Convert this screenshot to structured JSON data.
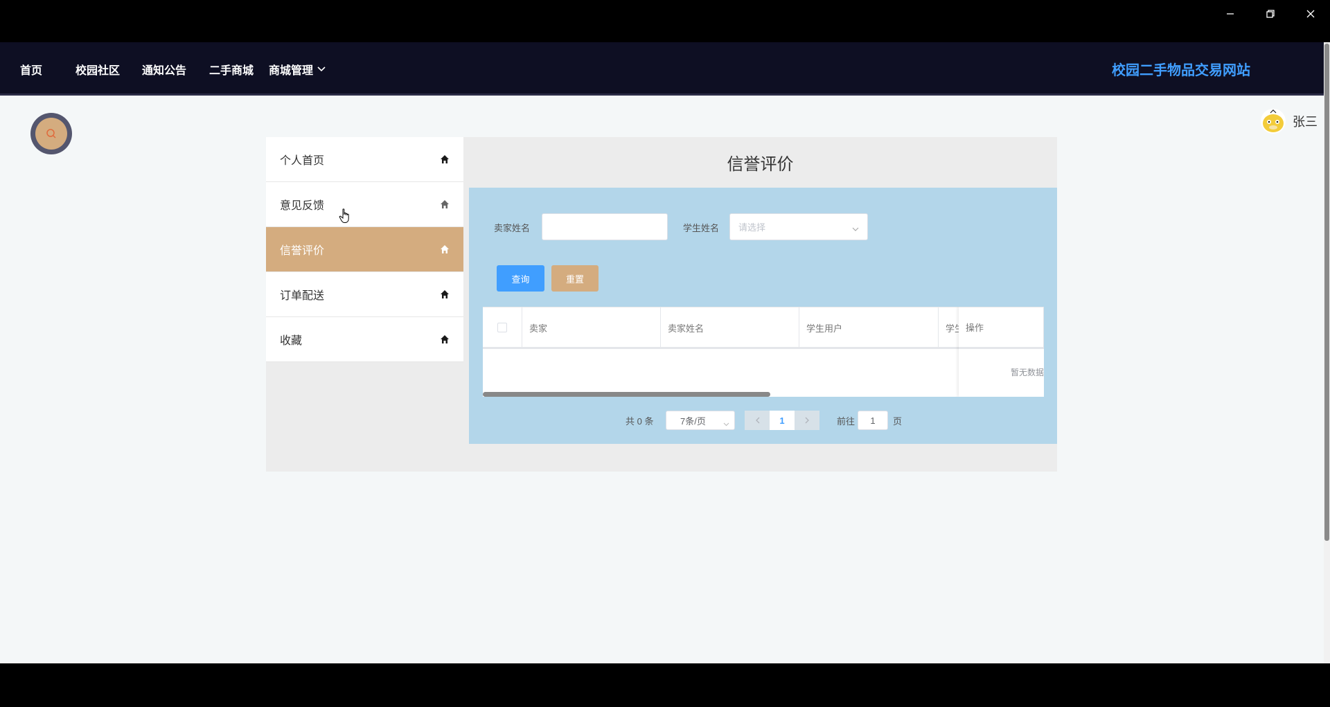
{
  "window": {
    "minimize_icon": "minimize-icon",
    "restore_icon": "restore-icon",
    "close_icon": "close-icon"
  },
  "nav": {
    "items": [
      {
        "label": "首页"
      },
      {
        "label": "校园社区"
      },
      {
        "label": "通知公告"
      },
      {
        "label": "二手商城"
      },
      {
        "label": "商城管理"
      }
    ],
    "site_title": "校园二手物品交易网站"
  },
  "user": {
    "name": "张三"
  },
  "sidebar": {
    "items": [
      {
        "label": "个人首页"
      },
      {
        "label": "意见反馈"
      },
      {
        "label": "信誉评价"
      },
      {
        "label": "订单配送"
      },
      {
        "label": "收藏"
      }
    ],
    "active_index": 2
  },
  "page": {
    "title": "信誉评价"
  },
  "filters": {
    "seller_label": "卖家姓名",
    "seller_value": "",
    "student_label": "学生姓名",
    "student_placeholder": "请选择",
    "query_button": "查询",
    "reset_button": "重置"
  },
  "table": {
    "columns": [
      "卖家",
      "卖家姓名",
      "学生用户",
      "学生",
      "操作"
    ],
    "empty_text": "暂无数据"
  },
  "pagination": {
    "total": "共 0 条",
    "page_size": "7条/页",
    "current_page": "1",
    "goto_label": "前往",
    "goto_value": "1",
    "goto_suffix": "页"
  },
  "colors": {
    "navbar": "#0e0f23",
    "accent": "#d4ac7f",
    "primary": "#409eff",
    "content_bg": "#b3d6ea"
  }
}
